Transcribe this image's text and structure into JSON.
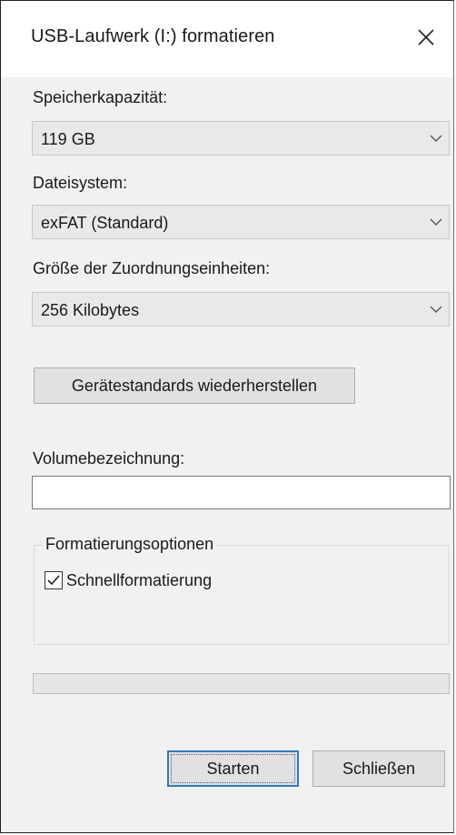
{
  "window": {
    "title": "USB-Laufwerk (I:) formatieren"
  },
  "capacity": {
    "label": "Speicherkapazität:",
    "value": "119 GB"
  },
  "filesystem": {
    "label": "Dateisystem:",
    "value": "exFAT (Standard)"
  },
  "allocation": {
    "label": "Größe der Zuordnungseinheiten:",
    "value": "256 Kilobytes"
  },
  "restore_defaults": {
    "label": "Gerätestandards wiederherstellen"
  },
  "volume": {
    "label": "Volumebezeichnung:",
    "value": ""
  },
  "options": {
    "title": "Formatierungsoptionen",
    "quick_format": {
      "label": "Schnellformatierung",
      "checked": true
    }
  },
  "progress": {
    "fraction": 0
  },
  "buttons": {
    "start": "Starten",
    "close": "Schließen"
  },
  "icons": {
    "close": "close-icon",
    "dropdown": "chevron-down-icon",
    "check": "checkmark-icon"
  },
  "colors": {
    "default_button_border": "#2a7ccd",
    "progress_fill": "#06b025"
  }
}
